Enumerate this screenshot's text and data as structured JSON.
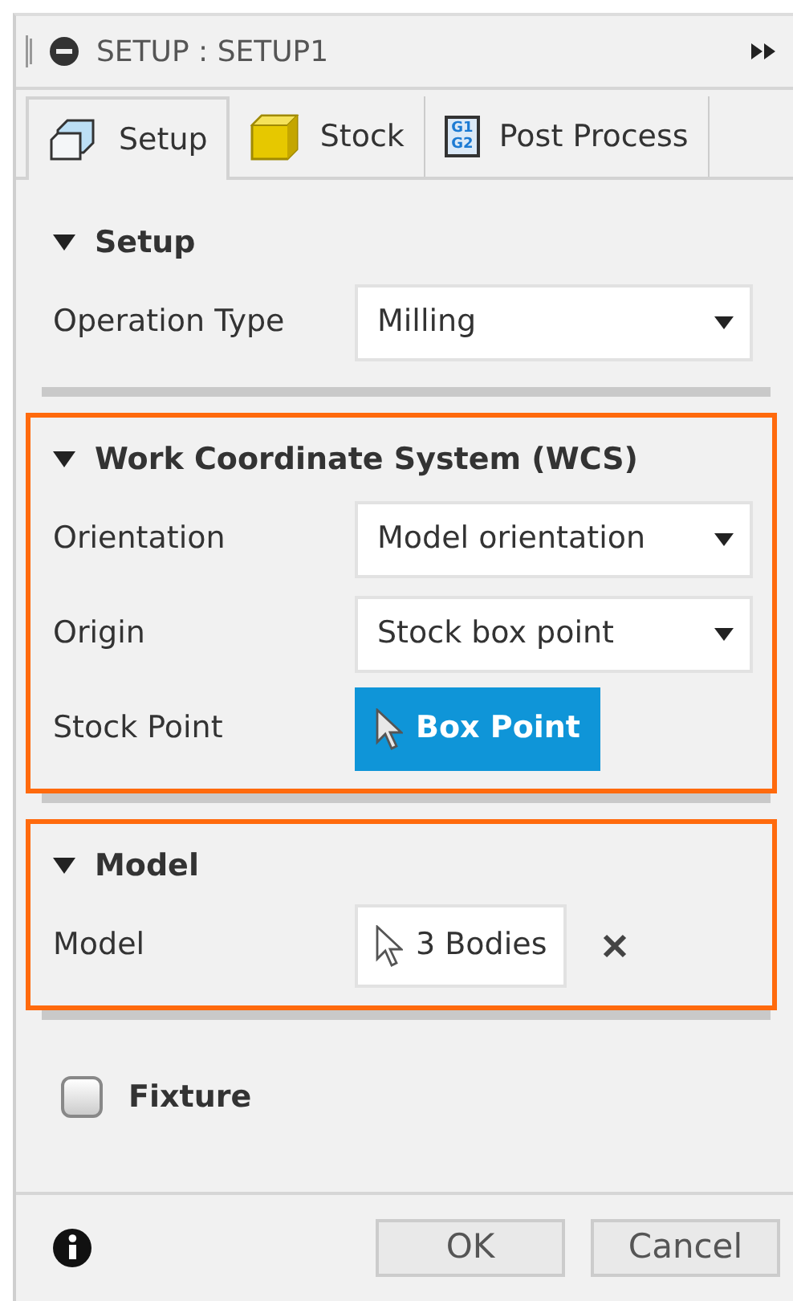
{
  "title_bar": {
    "title": "SETUP : SETUP1"
  },
  "tabs": [
    {
      "kind": "setup",
      "label": "Setup",
      "selected": true
    },
    {
      "kind": "stock",
      "label": "Stock",
      "selected": false
    },
    {
      "kind": "post",
      "label": "Post Process",
      "icon_text": [
        "G1",
        "G2"
      ],
      "selected": false
    }
  ],
  "sections": [
    {
      "title": "Setup",
      "expanded": true,
      "highlighted": false,
      "rows": [
        {
          "kind": "select",
          "label": "Operation Type",
          "value": "Milling"
        }
      ]
    },
    {
      "title": "Work Coordinate System (WCS)",
      "expanded": true,
      "highlighted": true,
      "rows": [
        {
          "kind": "select",
          "label": "Orientation",
          "value": "Model orientation"
        },
        {
          "kind": "select",
          "label": "Origin",
          "value": "Stock box point"
        },
        {
          "kind": "selection",
          "label": "Stock Point",
          "value": "Box Point",
          "active": true,
          "clearable": false
        }
      ]
    },
    {
      "title": "Model",
      "expanded": true,
      "highlighted": true,
      "rows": [
        {
          "kind": "selection",
          "label": "Model",
          "value": "3 Bodies",
          "active": false,
          "clearable": true
        }
      ]
    }
  ],
  "fixture": {
    "label": "Fixture",
    "checked": false
  },
  "buttons": [
    "OK",
    "Cancel"
  ]
}
